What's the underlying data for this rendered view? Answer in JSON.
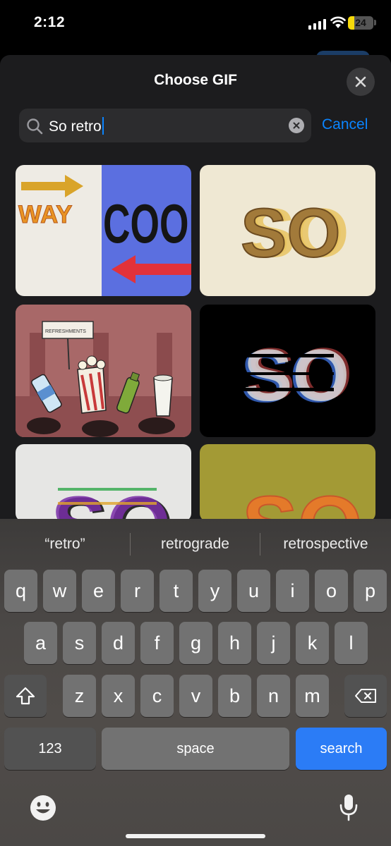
{
  "status_bar": {
    "time": "2:12",
    "battery_level": "24",
    "battery_fraction": 0.24,
    "battery_color": "#f5d90a",
    "icons": [
      "cellular-signal-icon",
      "wifi-icon",
      "battery-icon"
    ]
  },
  "sheet": {
    "title": "Choose GIF",
    "close_icon": "close-icon"
  },
  "search": {
    "value": "So retro",
    "search_icon": "magnifier-icon",
    "clear_icon": "clear-x-icon",
    "cancel_label": "Cancel"
  },
  "gifs": {
    "way_cool": {
      "word1": "WAY",
      "word2": "COOL"
    },
    "so_beige": {
      "text": "SO"
    },
    "refreshments": {
      "sign": "REFRESHMENTS"
    },
    "so_glitch_black": {
      "text": "SO"
    },
    "so_glitch_white": {
      "text": "SO"
    },
    "so_olive": {
      "text": "SO"
    }
  },
  "keyboard": {
    "suggestions": [
      "“retro”",
      "retrograde",
      "retrospective"
    ],
    "row1": [
      "q",
      "w",
      "e",
      "r",
      "t",
      "y",
      "u",
      "i",
      "o",
      "p"
    ],
    "row2": [
      "a",
      "s",
      "d",
      "f",
      "g",
      "h",
      "j",
      "k",
      "l"
    ],
    "row3": [
      "z",
      "x",
      "c",
      "v",
      "b",
      "n",
      "m"
    ],
    "numbers_label": "123",
    "space_label": "space",
    "search_label": "search",
    "accent_color": "#2b7cf6",
    "icons": [
      "shift-icon",
      "delete-icon",
      "emoji-icon",
      "microphone-icon"
    ]
  }
}
